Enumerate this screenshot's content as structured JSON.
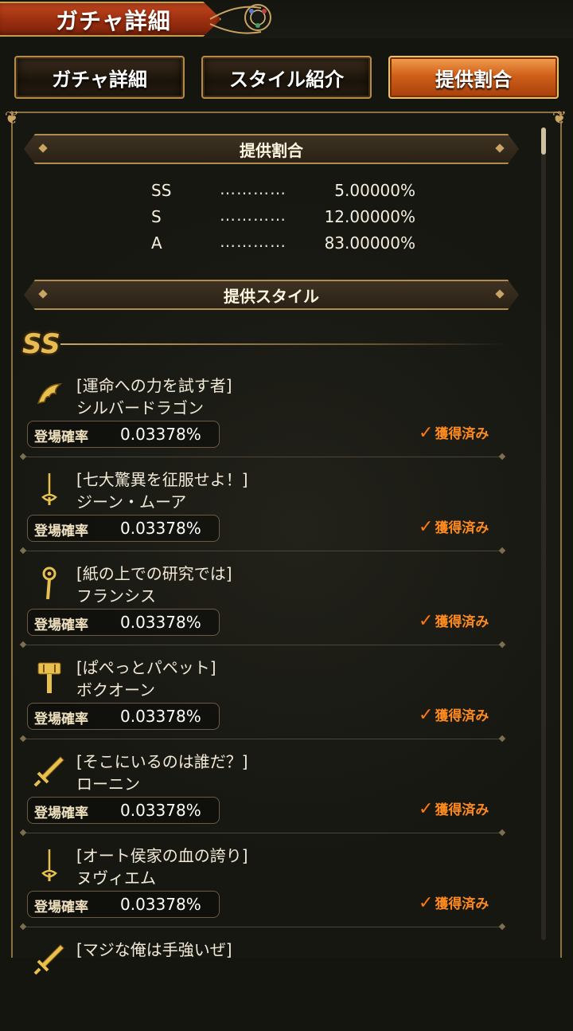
{
  "header": {
    "title": "ガチャ詳細"
  },
  "tabs": [
    {
      "label": "ガチャ詳細",
      "active": false
    },
    {
      "label": "スタイル紹介",
      "active": false
    },
    {
      "label": "提供割合",
      "active": true
    }
  ],
  "rates_section": {
    "title": "提供割合",
    "rows": [
      {
        "rarity": "SS",
        "dots": "…………",
        "value": "5.00000%"
      },
      {
        "rarity": "S",
        "dots": "…………",
        "value": "12.00000%"
      },
      {
        "rarity": "A",
        "dots": "…………",
        "value": "83.00000%"
      }
    ]
  },
  "styles_section": {
    "title": "提供スタイル",
    "rarity_mark": "SS",
    "prob_label": "登場確率",
    "owned_label": "獲得済み",
    "items": [
      {
        "subtitle": "[運命への力を試す者]",
        "name": "シルバードラゴン",
        "prob": "0.03378%",
        "icon": "claw-icon"
      },
      {
        "subtitle": "[七大驚異を征服せよ！]",
        "name": "ジーン・ムーア",
        "prob": "0.03378%",
        "icon": "rapier-icon"
      },
      {
        "subtitle": "[紙の上での研究では]",
        "name": "フランシス",
        "prob": "0.03378%",
        "icon": "staff-icon"
      },
      {
        "subtitle": "[ぱぺっとパペット]",
        "name": "ボクオーン",
        "prob": "0.03378%",
        "icon": "hammer-icon"
      },
      {
        "subtitle": "[そこにいるのは誰だ？]",
        "name": "ローニン",
        "prob": "0.03378%",
        "icon": "sword-icon"
      },
      {
        "subtitle": "[オート侯家の血の誇り]",
        "name": "ヌヴィエム",
        "prob": "0.03378%",
        "icon": "rapier-icon"
      },
      {
        "subtitle": "[マジな俺は手強いぜ]",
        "name": "",
        "prob": "",
        "icon": "sword-icon"
      }
    ]
  },
  "colors": {
    "accent": "#c9a462",
    "owned": "#ff8a1e",
    "active_tab": "#d0601a"
  }
}
